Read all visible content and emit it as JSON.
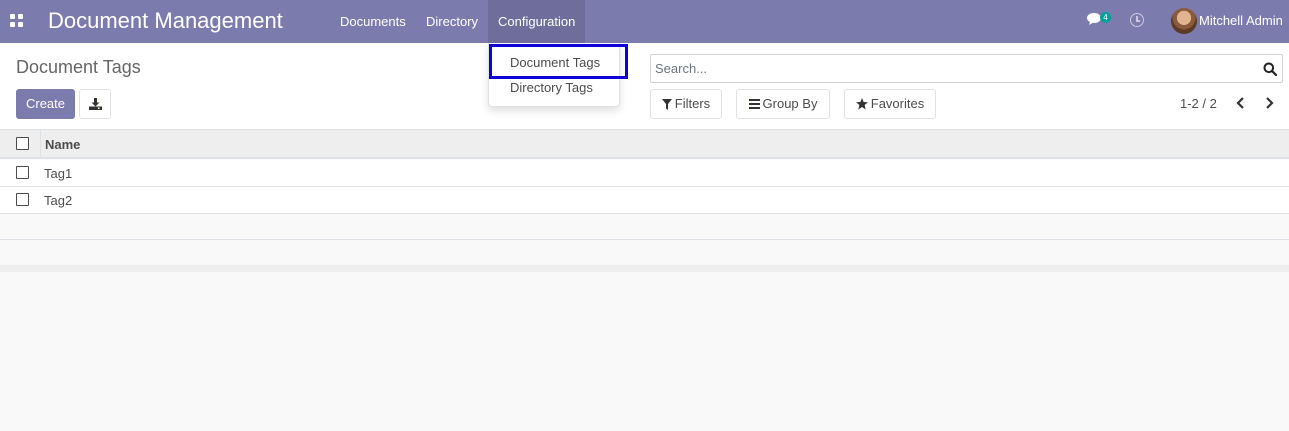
{
  "navbar": {
    "app_title": "Document Management",
    "menu": [
      {
        "label": "Documents"
      },
      {
        "label": "Directory"
      },
      {
        "label": "Configuration"
      }
    ],
    "chat_badge": "4",
    "user_name": "Mitchell Admin",
    "color": "#7c7bad"
  },
  "control_panel": {
    "title": "Document Tags",
    "create_label": "Create",
    "search_placeholder": "Search...",
    "filters_label": "Filters",
    "group_by_label": "Group By",
    "favorites_label": "Favorites",
    "pager_value": "1-2 / 2"
  },
  "list": {
    "column_name": "Name",
    "rows": [
      {
        "name": "Tag1"
      },
      {
        "name": "Tag2"
      }
    ]
  },
  "dropdown": {
    "items": [
      {
        "label": "Document Tags"
      },
      {
        "label": "Directory Tags"
      }
    ],
    "highlight_color": "#0d00d9"
  }
}
